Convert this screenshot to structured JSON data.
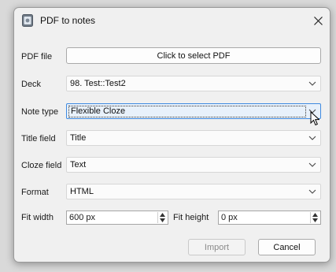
{
  "window": {
    "title": "PDF to notes",
    "icon": "anki-app-icon",
    "close_icon": "close-icon"
  },
  "form": {
    "pdf_file": {
      "label": "PDF file",
      "button": "Click to select PDF"
    },
    "deck": {
      "label": "Deck",
      "value": "98. Test::Test2"
    },
    "note_type": {
      "label": "Note type",
      "value": "Flexible Cloze"
    },
    "title_field": {
      "label": "Title field",
      "value": "Title"
    },
    "cloze_field": {
      "label": "Cloze field",
      "value": "Text"
    },
    "format": {
      "label": "Format",
      "value": "HTML"
    },
    "fit_width": {
      "label": "Fit width",
      "value": "600 px"
    },
    "fit_height": {
      "label": "Fit height",
      "value": "0 px"
    }
  },
  "buttons": {
    "import": "Import",
    "cancel": "Cancel"
  },
  "colors": {
    "focus_border": "#3f8ae0",
    "focus_fill": "#e8f1fb",
    "disabled_text": "#8a8a8a"
  }
}
